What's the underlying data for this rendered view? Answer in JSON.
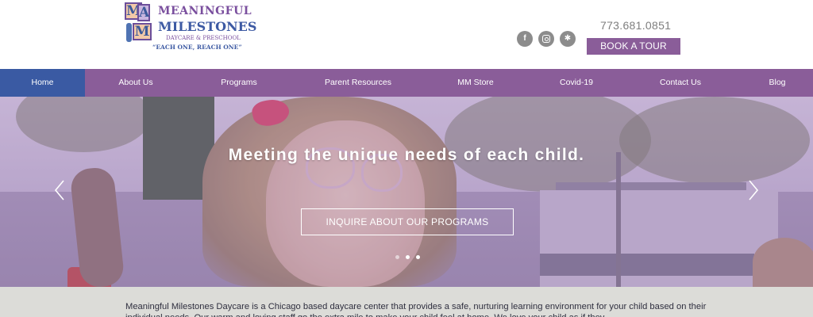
{
  "logo": {
    "blocks": [
      "M",
      "A",
      "M"
    ],
    "line1": "MEANINGFUL",
    "line2": "MILESTONES",
    "line3": "DAYCARE & PRESCHOOL",
    "line4": "“EACH ONE, REACH ONE”"
  },
  "header": {
    "phone": "773.681.0851",
    "social": [
      {
        "icon": "facebook-icon",
        "glyph": "f"
      },
      {
        "icon": "instagram-icon",
        "glyph": ""
      },
      {
        "icon": "yelp-icon",
        "glyph": "✱"
      }
    ],
    "book_label": "BOOK A TOUR"
  },
  "nav": {
    "items": [
      {
        "label": "Home",
        "active": true
      },
      {
        "label": "About Us"
      },
      {
        "label": "Programs"
      },
      {
        "label": "Parent Resources"
      },
      {
        "label": "MM Store"
      },
      {
        "label": "Covid-19"
      },
      {
        "label": "Contact Us"
      },
      {
        "label": "Blog"
      }
    ]
  },
  "hero": {
    "title": "Meeting the unique needs of each child.",
    "button_label": "INQUIRE ABOUT OUR PROGRAMS",
    "slide_count": 3,
    "active_slide": 2
  },
  "intro": {
    "text": "Meaningful Milestones Daycare is a Chicago based daycare center that provides a safe, nurturing learning environment for your child based on their individual needs. Our warm and loving staff go the extra mile to make your child feel at home. We love your child as if they"
  },
  "colors": {
    "brand_purple": "#8a5d99",
    "active_blue": "#3a5aa3",
    "phone_gray": "#7e7e7e"
  }
}
